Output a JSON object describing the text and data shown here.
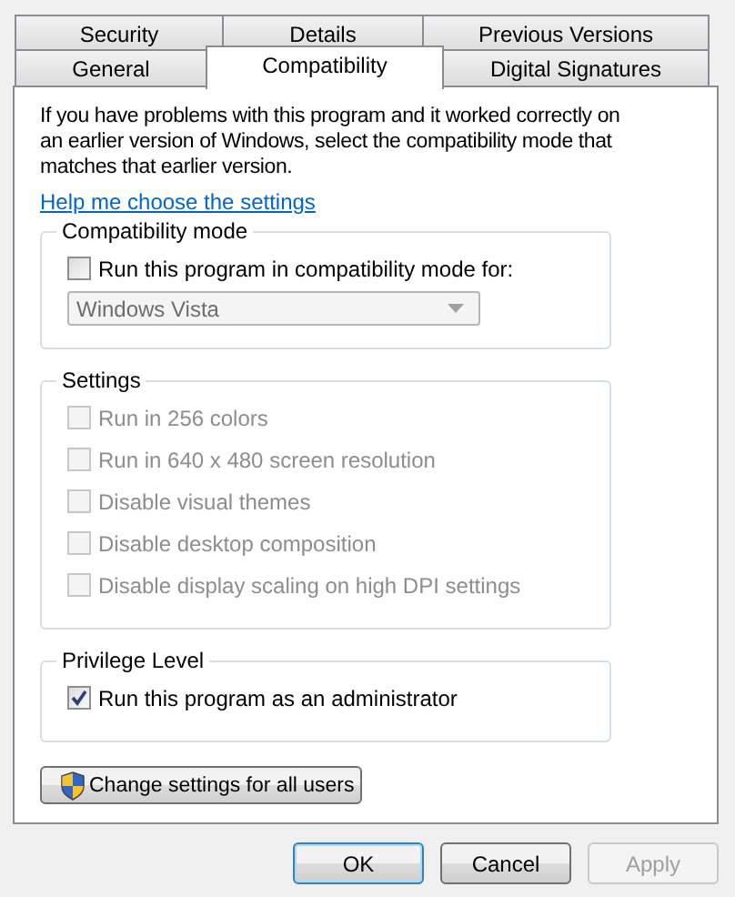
{
  "tab_rows": [
    [
      {
        "label": "Security",
        "selected": false
      },
      {
        "label": "Details",
        "selected": false
      },
      {
        "label": "Previous Versions",
        "selected": false
      }
    ],
    [
      {
        "label": "General",
        "selected": false
      },
      {
        "label": "Compatibility",
        "selected": true
      },
      {
        "label": "Digital Signatures",
        "selected": false
      }
    ]
  ],
  "intro": "If you have problems with this program and it worked correctly on an earlier version of Windows, select the compatibility mode that matches that earlier version.",
  "help_link": "Help me choose the settings",
  "groups": [
    {
      "title": "Compatibility mode",
      "options": [
        {
          "label": "Run this program in compatibility mode for:",
          "checked": false,
          "disabled": false
        }
      ],
      "dropdown": {
        "value": "Windows Vista",
        "disabled": true
      }
    },
    {
      "title": "Settings",
      "options": [
        {
          "label": "Run in 256 colors",
          "checked": false,
          "disabled": true
        },
        {
          "label": "Run in 640 x 480 screen resolution",
          "checked": false,
          "disabled": true
        },
        {
          "label": "Disable visual themes",
          "checked": false,
          "disabled": true
        },
        {
          "label": "Disable desktop composition",
          "checked": false,
          "disabled": true
        },
        {
          "label": "Disable display scaling on high DPI settings",
          "checked": false,
          "disabled": true
        }
      ]
    },
    {
      "title": "Privilege Level",
      "options": [
        {
          "label": "Run this program as an administrator",
          "checked": true,
          "disabled": false
        }
      ]
    }
  ],
  "change_button": {
    "label": "Change settings for all users"
  },
  "dialog_buttons": [
    {
      "label": "OK",
      "default": true,
      "disabled": false
    },
    {
      "label": "Cancel",
      "default": false,
      "disabled": false
    },
    {
      "label": "Apply",
      "default": false,
      "disabled": true
    }
  ]
}
